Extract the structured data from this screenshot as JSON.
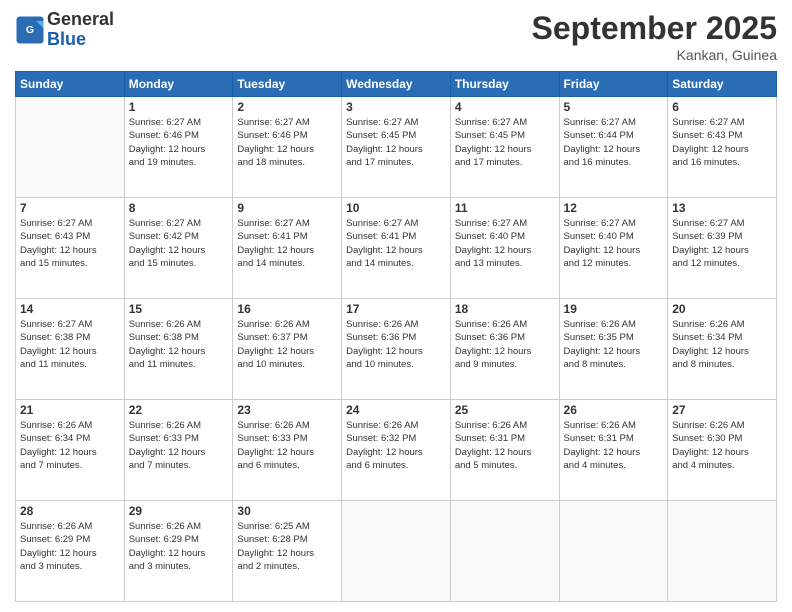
{
  "header": {
    "logo_general": "General",
    "logo_blue": "Blue",
    "month_title": "September 2025",
    "location": "Kankan, Guinea"
  },
  "weekdays": [
    "Sunday",
    "Monday",
    "Tuesday",
    "Wednesday",
    "Thursday",
    "Friday",
    "Saturday"
  ],
  "weeks": [
    [
      {
        "day": "",
        "info": ""
      },
      {
        "day": "1",
        "info": "Sunrise: 6:27 AM\nSunset: 6:46 PM\nDaylight: 12 hours\nand 19 minutes."
      },
      {
        "day": "2",
        "info": "Sunrise: 6:27 AM\nSunset: 6:46 PM\nDaylight: 12 hours\nand 18 minutes."
      },
      {
        "day": "3",
        "info": "Sunrise: 6:27 AM\nSunset: 6:45 PM\nDaylight: 12 hours\nand 17 minutes."
      },
      {
        "day": "4",
        "info": "Sunrise: 6:27 AM\nSunset: 6:45 PM\nDaylight: 12 hours\nand 17 minutes."
      },
      {
        "day": "5",
        "info": "Sunrise: 6:27 AM\nSunset: 6:44 PM\nDaylight: 12 hours\nand 16 minutes."
      },
      {
        "day": "6",
        "info": "Sunrise: 6:27 AM\nSunset: 6:43 PM\nDaylight: 12 hours\nand 16 minutes."
      }
    ],
    [
      {
        "day": "7",
        "info": "Sunrise: 6:27 AM\nSunset: 6:43 PM\nDaylight: 12 hours\nand 15 minutes."
      },
      {
        "day": "8",
        "info": "Sunrise: 6:27 AM\nSunset: 6:42 PM\nDaylight: 12 hours\nand 15 minutes."
      },
      {
        "day": "9",
        "info": "Sunrise: 6:27 AM\nSunset: 6:41 PM\nDaylight: 12 hours\nand 14 minutes."
      },
      {
        "day": "10",
        "info": "Sunrise: 6:27 AM\nSunset: 6:41 PM\nDaylight: 12 hours\nand 14 minutes."
      },
      {
        "day": "11",
        "info": "Sunrise: 6:27 AM\nSunset: 6:40 PM\nDaylight: 12 hours\nand 13 minutes."
      },
      {
        "day": "12",
        "info": "Sunrise: 6:27 AM\nSunset: 6:40 PM\nDaylight: 12 hours\nand 12 minutes."
      },
      {
        "day": "13",
        "info": "Sunrise: 6:27 AM\nSunset: 6:39 PM\nDaylight: 12 hours\nand 12 minutes."
      }
    ],
    [
      {
        "day": "14",
        "info": "Sunrise: 6:27 AM\nSunset: 6:38 PM\nDaylight: 12 hours\nand 11 minutes."
      },
      {
        "day": "15",
        "info": "Sunrise: 6:26 AM\nSunset: 6:38 PM\nDaylight: 12 hours\nand 11 minutes."
      },
      {
        "day": "16",
        "info": "Sunrise: 6:26 AM\nSunset: 6:37 PM\nDaylight: 12 hours\nand 10 minutes."
      },
      {
        "day": "17",
        "info": "Sunrise: 6:26 AM\nSunset: 6:36 PM\nDaylight: 12 hours\nand 10 minutes."
      },
      {
        "day": "18",
        "info": "Sunrise: 6:26 AM\nSunset: 6:36 PM\nDaylight: 12 hours\nand 9 minutes."
      },
      {
        "day": "19",
        "info": "Sunrise: 6:26 AM\nSunset: 6:35 PM\nDaylight: 12 hours\nand 8 minutes."
      },
      {
        "day": "20",
        "info": "Sunrise: 6:26 AM\nSunset: 6:34 PM\nDaylight: 12 hours\nand 8 minutes."
      }
    ],
    [
      {
        "day": "21",
        "info": "Sunrise: 6:26 AM\nSunset: 6:34 PM\nDaylight: 12 hours\nand 7 minutes."
      },
      {
        "day": "22",
        "info": "Sunrise: 6:26 AM\nSunset: 6:33 PM\nDaylight: 12 hours\nand 7 minutes."
      },
      {
        "day": "23",
        "info": "Sunrise: 6:26 AM\nSunset: 6:33 PM\nDaylight: 12 hours\nand 6 minutes."
      },
      {
        "day": "24",
        "info": "Sunrise: 6:26 AM\nSunset: 6:32 PM\nDaylight: 12 hours\nand 6 minutes."
      },
      {
        "day": "25",
        "info": "Sunrise: 6:26 AM\nSunset: 6:31 PM\nDaylight: 12 hours\nand 5 minutes."
      },
      {
        "day": "26",
        "info": "Sunrise: 6:26 AM\nSunset: 6:31 PM\nDaylight: 12 hours\nand 4 minutes."
      },
      {
        "day": "27",
        "info": "Sunrise: 6:26 AM\nSunset: 6:30 PM\nDaylight: 12 hours\nand 4 minutes."
      }
    ],
    [
      {
        "day": "28",
        "info": "Sunrise: 6:26 AM\nSunset: 6:29 PM\nDaylight: 12 hours\nand 3 minutes."
      },
      {
        "day": "29",
        "info": "Sunrise: 6:26 AM\nSunset: 6:29 PM\nDaylight: 12 hours\nand 3 minutes."
      },
      {
        "day": "30",
        "info": "Sunrise: 6:25 AM\nSunset: 6:28 PM\nDaylight: 12 hours\nand 2 minutes."
      },
      {
        "day": "",
        "info": ""
      },
      {
        "day": "",
        "info": ""
      },
      {
        "day": "",
        "info": ""
      },
      {
        "day": "",
        "info": ""
      }
    ]
  ]
}
